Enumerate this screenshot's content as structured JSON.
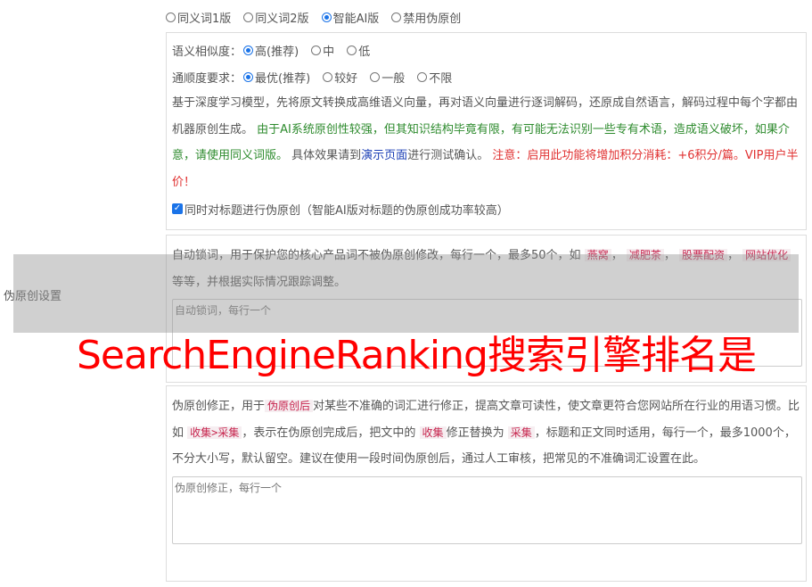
{
  "side_label": "伪原创设置",
  "mode_options": [
    {
      "label": "同义词1版",
      "checked": false
    },
    {
      "label": "同义词2版",
      "checked": false
    },
    {
      "label": "智能AI版",
      "checked": true
    },
    {
      "label": "禁用伪原创",
      "checked": false
    }
  ],
  "similarity": {
    "label": "语义相似度：",
    "options": [
      "高(推荐)",
      "中",
      "低"
    ]
  },
  "fluency": {
    "label": "通顺度要求：",
    "options": [
      "最优(推荐)",
      "较好",
      "一般",
      "不限"
    ]
  },
  "description": {
    "part1": "基于深度学习模型，先将原文转换成高维语义向量，再对语义向量进行逐词解码，还原成自然语言，解码过程中每个字都由机器原创生成。",
    "part2_green": "由于AI系统原创性较强，但其知识结构毕竟有限，有可能无法识别一些专有术语，造成语义破坏，如果介意，请使用同义词版。",
    "part3": "具体效果请到",
    "link": "演示页面",
    "part4": "进行测试确认。",
    "note_red": "注意：启用此功能将增加积分消耗：+6积分/篇。VIP用户半价！"
  },
  "title_checkbox_label": "同时对标题进行伪原创（智能AI版对标题的伪原创成功率较高）",
  "lock": {
    "text1": "自动锁词，用于保护您的核心产品词不被伪原创修改，每行一个，最多50个，如",
    "tags": [
      "燕窝",
      "减肥茶",
      "股票配资",
      "网站优化"
    ],
    "text2": "等等，并根据实际情况跟踪调整。",
    "placeholder": "自动锁词，每行一个"
  },
  "fix": {
    "text1": "伪原创修正，用于",
    "tag1": "伪原创后",
    "text2": "对某些不准确的词汇进行修正，提高文章可读性，使文章更符合您网站所在行业的用语习惯。比如",
    "tag2": "收集>采集",
    "text3": "，表示在伪原创完成后，把文中的",
    "tag3": "收集",
    "text4": "修正替换为",
    "tag4": "采集",
    "text5": "，标题和正文同时适用，每行一个，最多1000个，不分大小写，默认留空。建议在使用一段时间伪原创后，通过人工审核，把常见的不准确词汇设置在此。",
    "placeholder": "伪原创修正，每行一个"
  },
  "watermark": "SearchEngineRanking搜索引擎排名是"
}
